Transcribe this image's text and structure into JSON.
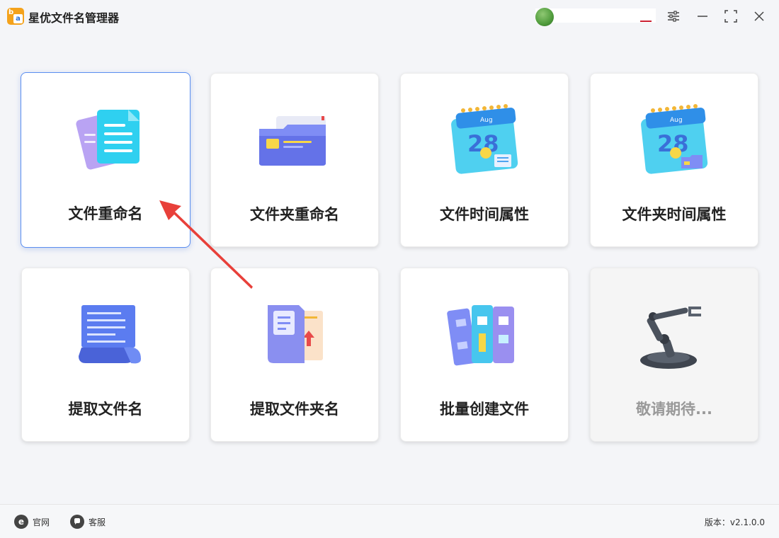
{
  "app": {
    "title": "星优文件名管理器"
  },
  "cards": [
    {
      "label": "文件重命名",
      "icon": "document-stack-icon"
    },
    {
      "label": "文件夹重命名",
      "icon": "folder-icon"
    },
    {
      "label": "文件时间属性",
      "icon": "calendar-icon"
    },
    {
      "label": "文件夹时间属性",
      "icon": "calendar-folder-icon"
    },
    {
      "label": "提取文件名",
      "icon": "scroll-document-icon"
    },
    {
      "label": "提取文件夹名",
      "icon": "book-folder-icon"
    },
    {
      "label": "批量创建文件",
      "icon": "binders-icon"
    },
    {
      "label": "敬请期待...",
      "icon": "robot-arm-icon"
    }
  ],
  "calendar": {
    "month": "Aug",
    "day": "28"
  },
  "footer": {
    "website": "官网",
    "support": "客服",
    "version": "版本：v2.1.0.0"
  },
  "colors": {
    "accent": "#5b8ef0",
    "arrow": "#e8403a",
    "logo": "#f4a21b"
  }
}
